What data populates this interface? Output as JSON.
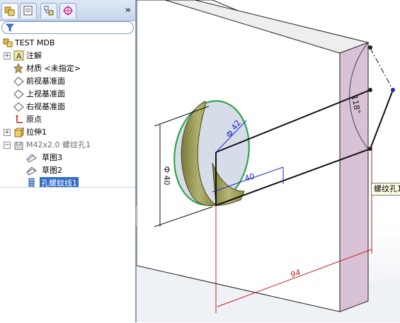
{
  "tree": {
    "root": "TEST MDB",
    "items": [
      {
        "label": "注解"
      },
      {
        "label": "材质 <未指定>"
      },
      {
        "label": "前视基准面"
      },
      {
        "label": "上视基准面"
      },
      {
        "label": "右视基准面"
      },
      {
        "label": "原点"
      },
      {
        "label": "拉伸1"
      },
      {
        "label": "M42x2.0 螺纹孔1"
      },
      {
        "label": "草图3"
      },
      {
        "label": "草图2"
      },
      {
        "label": "孔螺蚊线1"
      }
    ]
  },
  "dimensions": {
    "d1": "Ф 42",
    "d2": "40",
    "d3": "Ф 40",
    "d4": "94",
    "d5": "118°"
  },
  "tooltip": "螺纹孔1",
  "colors": {
    "dimension_blue": "#1e28c8",
    "dimension_red": "#c81e1e",
    "face_pink": "#d9c2d6",
    "thread_olive": "#9a9a4a"
  }
}
